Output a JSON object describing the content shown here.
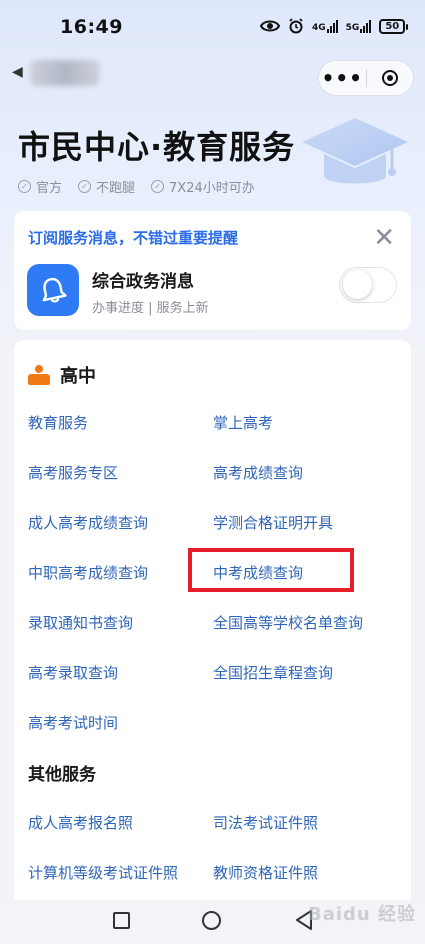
{
  "status_bar": {
    "time": "16:49",
    "net1": "4G",
    "net2": "5G",
    "battery": "50"
  },
  "nav": {
    "back_icon": "chevron-left-icon",
    "more_icon": "more-dots-icon",
    "close_icon": "target-icon"
  },
  "header": {
    "title": "市民中心·教育服务",
    "tags": [
      "官方",
      "不跑腿",
      "7X24小时可办"
    ]
  },
  "subscribe": {
    "prompt": "订阅服务消息，不错过重要提醒",
    "name": "综合政务消息",
    "desc": "办事进度 | 服务上新",
    "enabled": false
  },
  "services": {
    "section_label": "高中",
    "items": [
      "教育服务",
      "掌上高考",
      "高考服务专区",
      "高考成绩查询",
      "成人高考成绩查询",
      "学测合格证明开具",
      "中职高考成绩查询",
      "中考成绩查询",
      "录取通知书查询",
      "全国高等学校名单查询",
      "高考录取查询",
      "全国招生章程查询",
      "高考考试时间"
    ],
    "highlighted": "中考成绩查询",
    "other_label": "其他服务",
    "other_items": [
      "成人高考报名照",
      "司法考试证件照",
      "计算机等级考试证件照",
      "教师资格证件照"
    ]
  },
  "watermark": "Baidu 经验",
  "colors": {
    "accent": "#2f66b8",
    "highlight_box": "#e41f2a",
    "section_icon": "#f17a18",
    "subscribe_title": "#2b6de8"
  }
}
